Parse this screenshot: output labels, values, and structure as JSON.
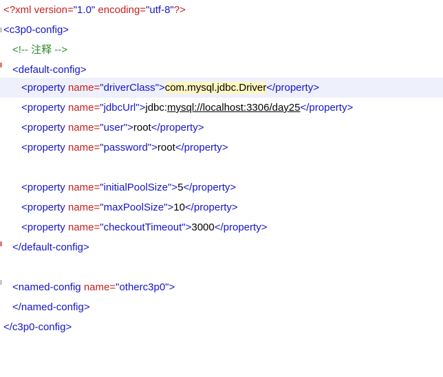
{
  "lines": [
    {
      "pi_open": "<?",
      "pi_name": "xml",
      "attr1": " version=",
      "val1": "\"1.0\"",
      "attr2": " encoding=",
      "val2": "\"utf-8\"",
      "pi_close": "?>"
    },
    {
      "tag": "<c3p0-config>"
    },
    {
      "comment": "<!-- 注释 -->"
    },
    {
      "tag": "<default-config>"
    },
    {
      "open": "<property ",
      "attr": "name=",
      "value": "\"driverClass\"",
      "gt": ">",
      "text": "com.mysql.jdbc.Driver",
      "close": "</property>"
    },
    {
      "open": "<property ",
      "attr": "name=",
      "value": "\"jdbcUrl\"",
      "gt": ">",
      "text_prefix": "jdbc:",
      "text_url": "mysql://localhost:3306/day25",
      "close": "</property>"
    },
    {
      "open": "<property ",
      "attr": "name=",
      "value": "\"user\"",
      "gt": ">",
      "text": "root",
      "close": "</property>"
    },
    {
      "open": "<property ",
      "attr": "name=",
      "value": "\"password\"",
      "gt": ">",
      "text": "root",
      "close": "</property>"
    },
    {
      "open": "<property ",
      "attr": "name=",
      "value": "\"initialPoolSize\"",
      "gt": ">",
      "text": "5",
      "close": "</property>"
    },
    {
      "open": "<property ",
      "attr": "name=",
      "value": "\"maxPoolSize\"",
      "gt": ">",
      "text": "10",
      "close": "</property>"
    },
    {
      "open": "<property ",
      "attr": "name=",
      "value": "\"checkoutTimeout\"",
      "gt": ">",
      "text": "3000",
      "close": "</property>"
    },
    {
      "tag": "</default-config>"
    },
    {
      "open": "<named-config ",
      "attr": "name=",
      "value": "\"otherc3p0\"",
      "gt": ">"
    },
    {
      "tag": "</named-config>"
    },
    {
      "tag": "</c3p0-config>"
    }
  ],
  "colors": {
    "tag": "#1414c8",
    "attribute": "#c81e1e",
    "comment": "#2f8a2f",
    "text": "#000000",
    "current_line": "#eef0fb",
    "highlight": "#fff7c2"
  }
}
